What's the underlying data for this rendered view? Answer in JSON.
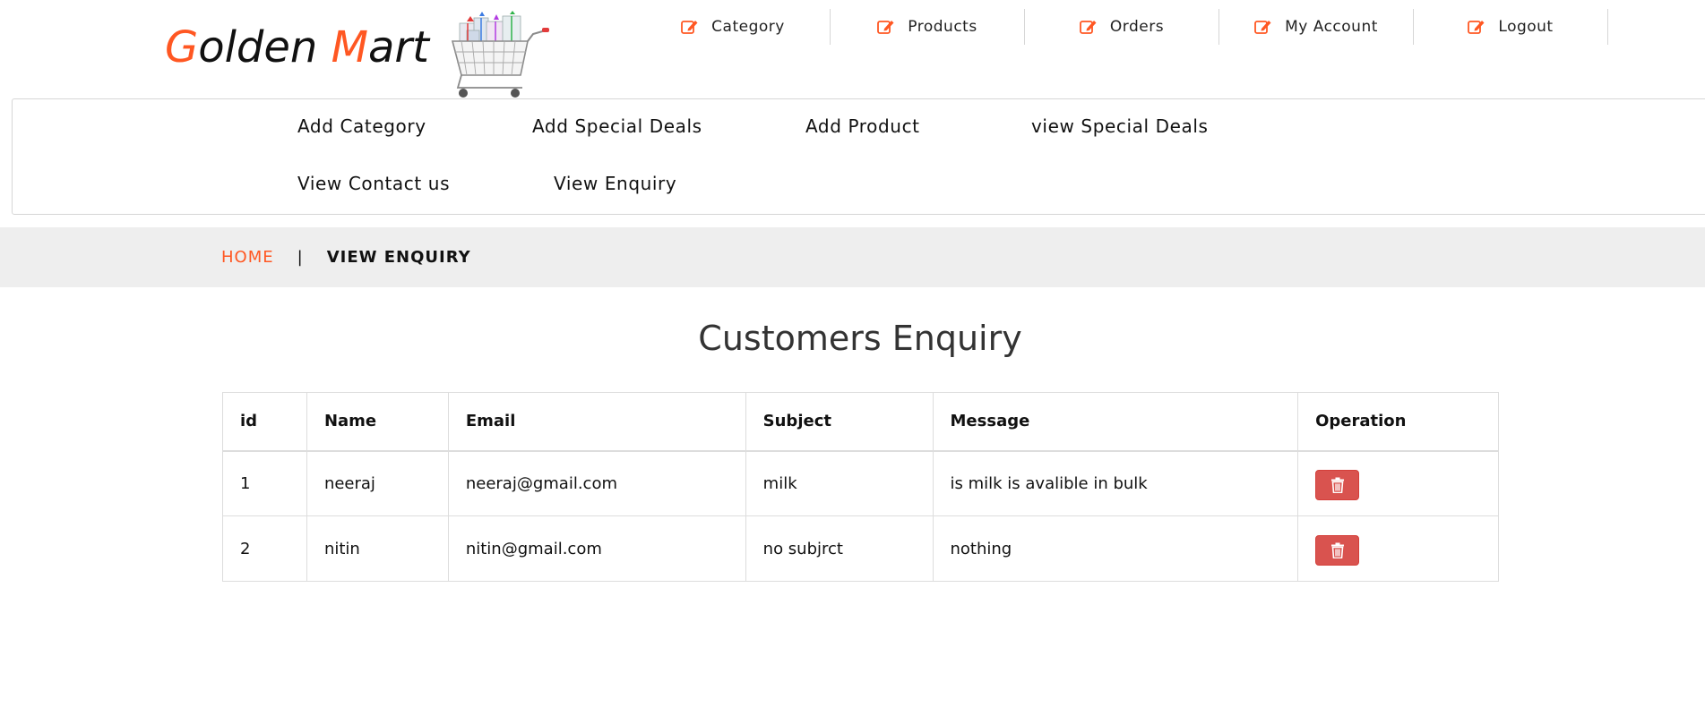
{
  "brand": {
    "logo_part1_accent": "G",
    "logo_part1_rest": "olden ",
    "logo_part2_accent": "M",
    "logo_part2_rest": "art",
    "accent_color": "#ff5722"
  },
  "top_nav": [
    {
      "label": "Category",
      "icon": "edit-icon"
    },
    {
      "label": "Products",
      "icon": "edit-icon"
    },
    {
      "label": "Orders",
      "icon": "edit-icon"
    },
    {
      "label": "My Account",
      "icon": "edit-icon"
    },
    {
      "label": "Logout",
      "icon": "edit-icon"
    }
  ],
  "submenu": {
    "add_category": "Add Category",
    "add_special_deals": "Add Special Deals",
    "add_product": "Add Product",
    "view_special_deals": "view Special Deals",
    "view_contact_us": "View Contact us",
    "view_enquiry": "View Enquiry"
  },
  "breadcrumb": {
    "home": "HOME",
    "separator": "|",
    "current": "VIEW ENQUIRY"
  },
  "page_title": "Customers Enquiry",
  "table": {
    "columns": [
      "id",
      "Name",
      "Email",
      "Subject",
      "Message",
      "Operation"
    ],
    "rows": [
      {
        "id": "1",
        "name": "neeraj",
        "email": "neeraj@gmail.com",
        "subject": "milk",
        "message": "is milk is avalible in bulk",
        "operation": "trash-icon"
      },
      {
        "id": "2",
        "name": "nitin",
        "email": "nitin@gmail.com",
        "subject": "no subjrct",
        "message": "nothing",
        "operation": "trash-icon"
      }
    ]
  },
  "colors": {
    "delete_button": "#d9534f",
    "breadcrumb_bg": "#eeeeee"
  }
}
